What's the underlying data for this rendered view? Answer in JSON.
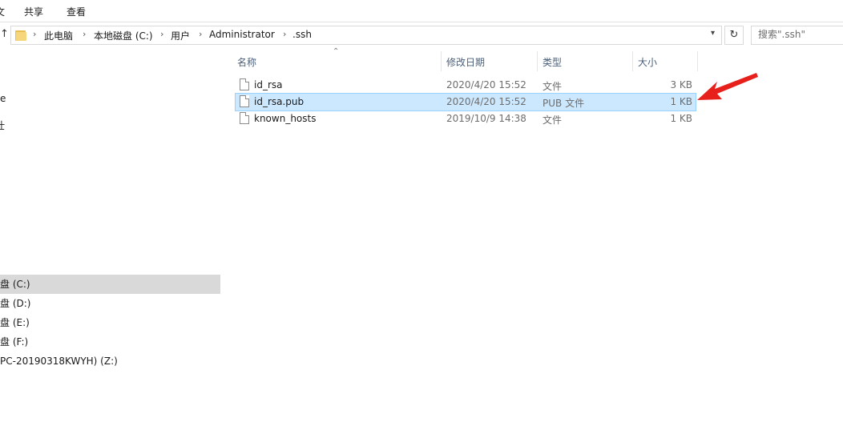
{
  "ribbon": {
    "tab_fragment": "文",
    "tabs": [
      "共享",
      "查看"
    ]
  },
  "address": {
    "breadcrumbs": [
      "此电脑",
      "本地磁盘 (C:)",
      "用户",
      "Administrator",
      ".ssh"
    ]
  },
  "search": {
    "placeholder": "搜索\".ssh\""
  },
  "nav": {
    "fragments": [
      "e",
      "壮"
    ],
    "drives": [
      {
        "label": "盘 (C:)",
        "selected": true
      },
      {
        "label": "盘 (D:)",
        "selected": false
      },
      {
        "label": "盘 (E:)",
        "selected": false
      },
      {
        "label": "盘 (F:)",
        "selected": false
      },
      {
        "label": "PC-20190318KWYH) (Z:)",
        "selected": false
      }
    ]
  },
  "columns": {
    "name": "名称",
    "date": "修改日期",
    "type": "类型",
    "size": "大小"
  },
  "files": [
    {
      "name": "id_rsa",
      "date": "2020/4/20 15:52",
      "type": "文件",
      "size": "3 KB",
      "selected": false
    },
    {
      "name": "id_rsa.pub",
      "date": "2020/4/20 15:52",
      "type": "PUB 文件",
      "size": "1 KB",
      "selected": true
    },
    {
      "name": "known_hosts",
      "date": "2019/10/9 14:38",
      "type": "文件",
      "size": "1 KB",
      "selected": false
    }
  ],
  "colors": {
    "selection_bg": "#cce8ff",
    "selection_border": "#99d1ff",
    "nav_selected_bg": "#d9d9d9",
    "header_text": "#4c607a",
    "annotation_arrow": "#e8201c"
  },
  "icons": {
    "folder": "folder-icon",
    "file": "file-icon",
    "refresh": "refresh-icon",
    "dropdown": "chevron-down-icon",
    "up": "up-arrow-icon",
    "sort": "sort-ascending-icon",
    "annotation": "red-pointer-arrow-icon"
  }
}
